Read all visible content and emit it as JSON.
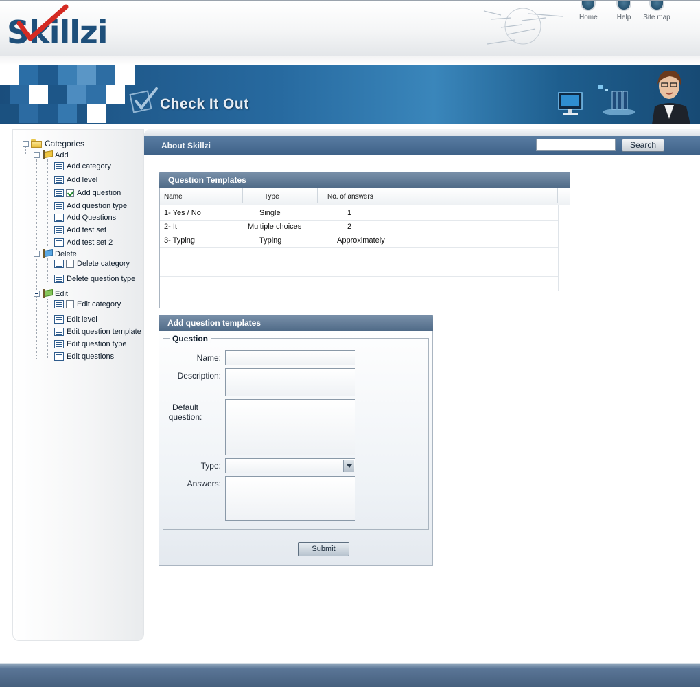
{
  "header": {
    "logo_text": "Skillzi",
    "nav": [
      {
        "label": "Home"
      },
      {
        "label": "Help"
      },
      {
        "label": "Site map"
      }
    ]
  },
  "banner": {
    "title": "Check It Out"
  },
  "sidebar": {
    "root_label": "Categories",
    "groups": [
      {
        "label": "Add",
        "items": [
          {
            "label": "Add category"
          },
          {
            "label": "Add level"
          },
          {
            "label": "Add question",
            "checkbox": true,
            "checked": true
          },
          {
            "label": "Add question type"
          },
          {
            "label": "Add Questions"
          },
          {
            "label": "Add test set"
          },
          {
            "label": "Add test set 2"
          }
        ]
      },
      {
        "label": "Delete",
        "items": [
          {
            "label": "Delete category",
            "checkbox": true,
            "checked": false
          },
          {
            "label": "Delete question type"
          }
        ]
      },
      {
        "label": "Edit",
        "items": [
          {
            "label": "Edit category",
            "checkbox": true,
            "checked": false
          },
          {
            "label": "Edit level"
          },
          {
            "label": "Edit question template"
          },
          {
            "label": "Edit question type"
          },
          {
            "label": "Edit questions"
          }
        ]
      }
    ]
  },
  "main": {
    "section_title": "About Skillzi",
    "search": {
      "value": "",
      "button_label": "Search"
    }
  },
  "question_templates": {
    "title": "Question Templates",
    "columns": [
      "Name",
      "Type",
      "No. of answers"
    ],
    "rows": [
      [
        "1- Yes / No",
        "Single",
        "1"
      ],
      [
        "2- It",
        "Multiple choices",
        "2"
      ],
      [
        "3- Typing",
        "Typing",
        "Approximately"
      ]
    ]
  },
  "add_form": {
    "title": "Add question templates",
    "legend": "Question",
    "fields": {
      "name": {
        "label": "Name:",
        "value": ""
      },
      "description": {
        "label": "Description:",
        "value": ""
      },
      "default_question": {
        "label_line1": "Default",
        "label_line2": "question:",
        "value": ""
      },
      "type": {
        "label": "Type:",
        "value": ""
      },
      "answers": {
        "label": "Answers:",
        "value": ""
      }
    },
    "submit_label": "Submit"
  },
  "colors": {
    "brand_blue": "#1e4f7a",
    "bar_blue": "#4f6a87",
    "logo_red": "#d42a22"
  }
}
